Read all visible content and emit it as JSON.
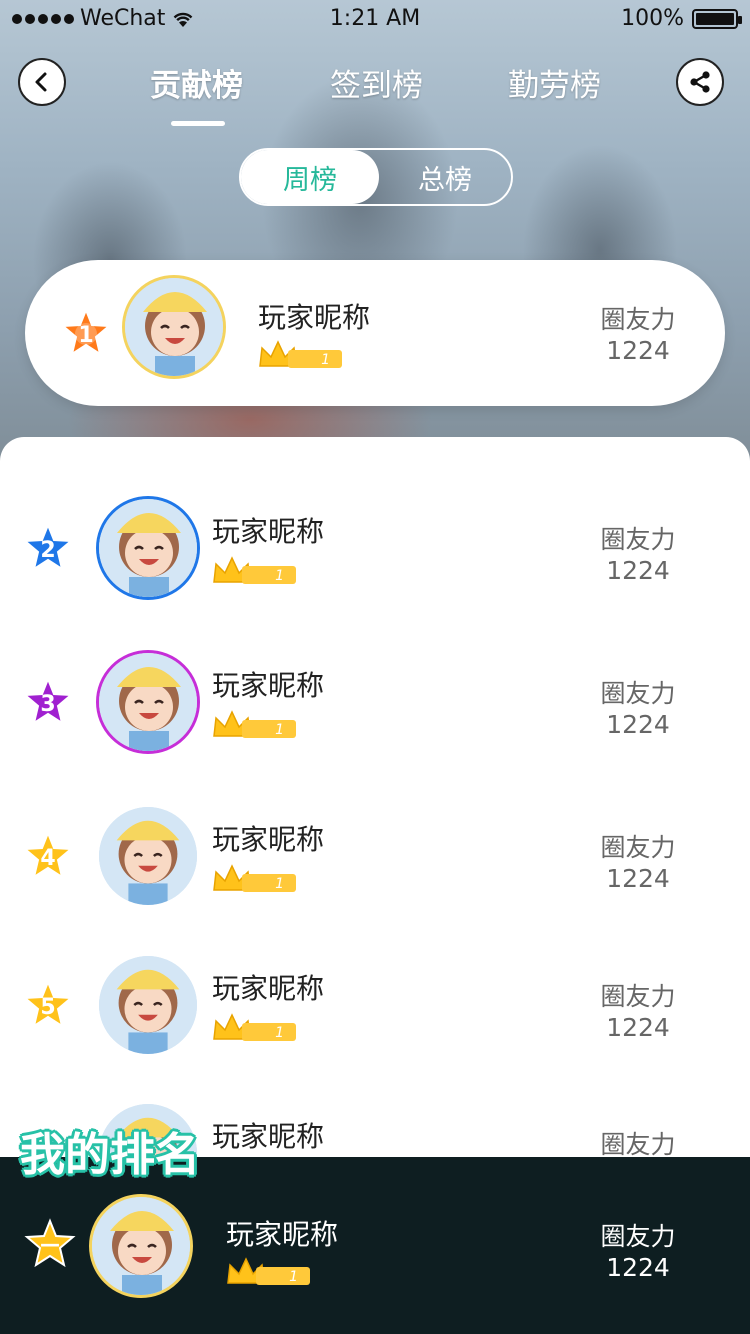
{
  "status_bar": {
    "carrier": "WeChat",
    "time": "1:21 AM",
    "battery": "100%"
  },
  "nav": {
    "tabs": [
      {
        "label": "贡献榜"
      },
      {
        "label": "签到榜"
      },
      {
        "label": "勤劳榜"
      }
    ],
    "active_tab": 0,
    "back_icon": "chevron-left-icon",
    "share_icon": "share-icon"
  },
  "period": {
    "options": [
      {
        "label": "周榜"
      },
      {
        "label": "总榜"
      }
    ],
    "selected": 0
  },
  "colors": {
    "accent": "#26b89a",
    "my_rank_bg": "#0e1e21",
    "level_badge": "#ffc93a"
  },
  "top_entry": {
    "rank": "1",
    "name": "玩家昵称",
    "level": "1",
    "score_label": "圈友力",
    "score": "1224",
    "medal_color": "#ff7a1a"
  },
  "ranking": [
    {
      "rank": "2",
      "name": "玩家昵称",
      "level": "1",
      "score_label": "圈友力",
      "score": "1224",
      "medal_color": "#1f77e8",
      "ring_color": "#1f77e8"
    },
    {
      "rank": "3",
      "name": "玩家昵称",
      "level": "1",
      "score_label": "圈友力",
      "score": "1224",
      "medal_color": "#a020d0",
      "ring_color": "#c62ed8"
    },
    {
      "rank": "4",
      "name": "玩家昵称",
      "level": "1",
      "score_label": "圈友力",
      "score": "1224",
      "medal_color": "#ffc21a",
      "ring_color": ""
    },
    {
      "rank": "5",
      "name": "玩家昵称",
      "level": "1",
      "score_label": "圈友力",
      "score": "1224",
      "medal_color": "#ffc21a",
      "ring_color": ""
    },
    {
      "rank": "",
      "name": "玩家昵称",
      "level": "",
      "score_label": "圈友力",
      "score": "",
      "medal_color": "",
      "ring_color": ""
    }
  ],
  "my_rank": {
    "title": "我的排名",
    "rank": "—",
    "name": "玩家昵称",
    "level": "1",
    "score_label": "圈友力",
    "score": "1224",
    "medal_color": "#ffc21a"
  }
}
